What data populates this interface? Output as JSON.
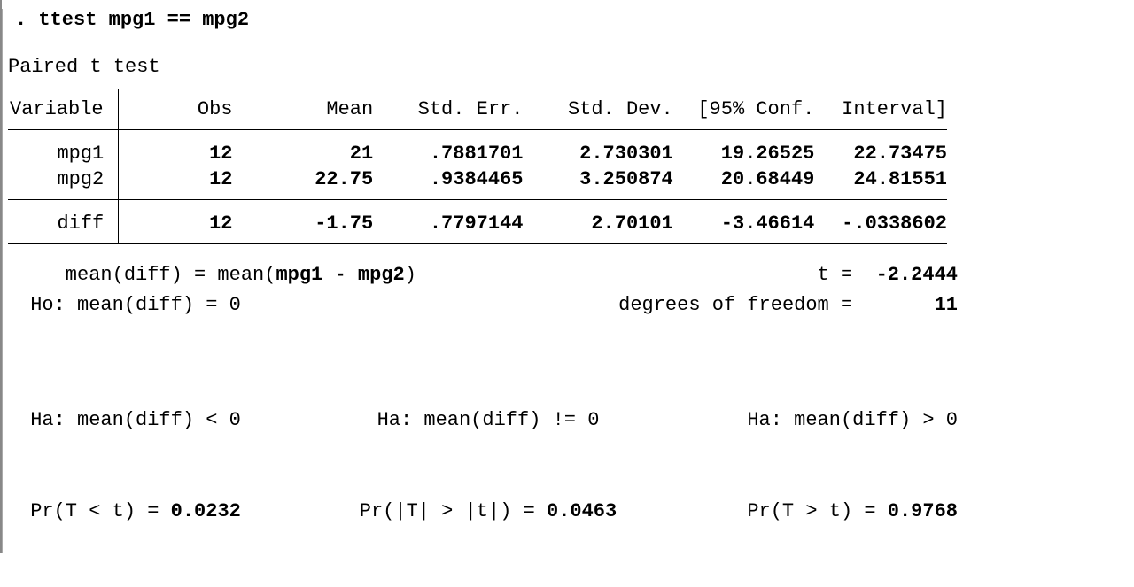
{
  "command": ". ttest mpg1 == mpg2",
  "title": "Paired t test",
  "headers": {
    "variable": "Variable",
    "obs": "Obs",
    "mean": "Mean",
    "se": "Std. Err.",
    "sd": "Std. Dev.",
    "ci_lo": "[95% Conf.",
    "ci_hi": "Interval]"
  },
  "rows": [
    {
      "var": "mpg1",
      "obs": "12",
      "mean": "21",
      "se": ".7881701",
      "sd": "2.730301",
      "lo": "19.26525",
      "hi": "22.73475"
    },
    {
      "var": "mpg2",
      "obs": "12",
      "mean": "22.75",
      "se": ".9384465",
      "sd": "3.250874",
      "lo": "20.68449",
      "hi": "24.81551"
    },
    {
      "var": "diff",
      "obs": "12",
      "mean": "-1.75",
      "se": ".7797144",
      "sd": "2.70101",
      "lo": "-3.46614",
      "hi": "-.0338602"
    }
  ],
  "summary": {
    "mean_diff_label": "    mean(diff) = mean(",
    "mean_diff_var": "mpg1 - mpg2",
    "mean_diff_close": ")",
    "t_label": "t = ",
    "t_value": " -2.2444",
    "ho_label": " Ho: mean(diff) = 0",
    "df_label": "degrees of freedom = ",
    "df_value": "      11"
  },
  "hypotheses": {
    "left": {
      "ha": " Ha: mean(diff) < 0",
      "pr_label": " Pr(T < t) = ",
      "pr_value": "0.0232"
    },
    "center": {
      "ha": "Ha: mean(diff) != 0",
      "pr_label": "Pr(|T| > |t|) = ",
      "pr_value": "0.0463"
    },
    "right": {
      "ha": "Ha: mean(diff) > 0",
      "pr_label": "Pr(T > t) = ",
      "pr_value": "0.9768"
    }
  }
}
